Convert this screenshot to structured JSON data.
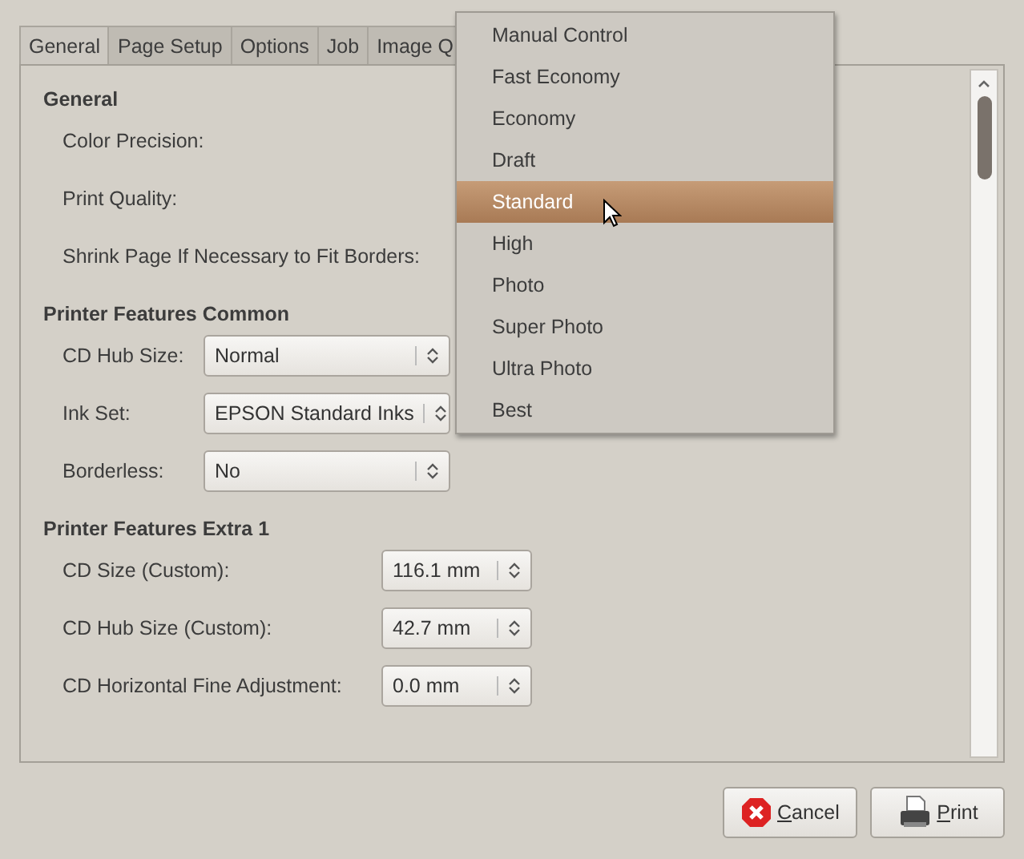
{
  "tabs": [
    {
      "label": "General",
      "selected": true
    },
    {
      "label": "Page Setup",
      "selected": false
    },
    {
      "label": "Options",
      "selected": false
    },
    {
      "label": "Job",
      "selected": false
    },
    {
      "label": "Image Q",
      "selected": false
    }
  ],
  "sections": [
    {
      "heading": "General",
      "rows": [
        {
          "kind": "label",
          "label": "Color Precision:"
        },
        {
          "kind": "label",
          "label": "Print Quality:"
        },
        {
          "kind": "label",
          "label": "Shrink Page If Necessary to Fit Borders:"
        }
      ]
    },
    {
      "heading": "Printer Features Common",
      "rows": [
        {
          "kind": "combo",
          "label": "CD Hub Size:",
          "value": "Normal"
        },
        {
          "kind": "combo",
          "label": "Ink Set:",
          "value": "EPSON Standard Inks"
        },
        {
          "kind": "combo",
          "label": "Borderless:",
          "value": "No"
        }
      ]
    },
    {
      "heading": "Printer Features Extra 1",
      "rows": [
        {
          "kind": "spin",
          "label": "CD Size (Custom):",
          "value": "116.1 mm"
        },
        {
          "kind": "spin",
          "label": "CD Hub Size (Custom):",
          "value": "42.7 mm"
        },
        {
          "kind": "spin",
          "label": "CD Horizontal Fine Adjustment:",
          "value": "0.0 mm"
        }
      ]
    }
  ],
  "menu": [
    {
      "label": "Manual Control",
      "selected": false
    },
    {
      "label": "Fast Economy",
      "selected": false
    },
    {
      "label": "Economy",
      "selected": false
    },
    {
      "label": "Draft",
      "selected": false
    },
    {
      "label": "Standard",
      "selected": true
    },
    {
      "label": "High",
      "selected": false
    },
    {
      "label": "Photo",
      "selected": false
    },
    {
      "label": "Super Photo",
      "selected": false
    },
    {
      "label": "Ultra Photo",
      "selected": false
    },
    {
      "label": "Best",
      "selected": false
    }
  ],
  "buttons": [
    {
      "kind": "cancel",
      "label": "Cancel"
    },
    {
      "kind": "print",
      "label": "Print"
    }
  ]
}
